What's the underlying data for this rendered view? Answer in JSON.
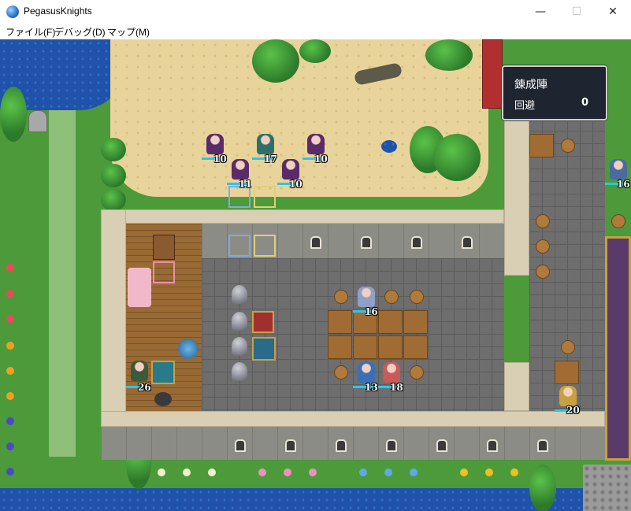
{
  "window": {
    "title": "PegasusKnights",
    "minimize_glyph": "—",
    "maximize_glyph": "☐",
    "close_glyph": "✕"
  },
  "menu": {
    "items": [
      "ファイル(F)",
      "デバッグ(D)",
      "マップ(M)"
    ]
  },
  "info_panel": {
    "title": "錬成陣",
    "stat_label": "回避",
    "stat_value": "0"
  },
  "units": [
    {
      "id": "enemy-1",
      "hp_label": "10",
      "color": "#5a2a6a"
    },
    {
      "id": "enemy-2",
      "hp_label": "17",
      "color": "#2f6f6a"
    },
    {
      "id": "enemy-3",
      "hp_label": "10",
      "color": "#5a2a6a"
    },
    {
      "id": "enemy-4",
      "hp_label": "11",
      "color": "#5a2a6a"
    },
    {
      "id": "enemy-5",
      "hp_label": "10",
      "color": "#5a2a6a"
    },
    {
      "id": "ally-1",
      "hp_label": "16",
      "color": "#8fa0c8"
    },
    {
      "id": "ally-2",
      "hp_label": "13",
      "color": "#3a6fb8"
    },
    {
      "id": "ally-3",
      "hp_label": "18",
      "color": "#c85a5a"
    },
    {
      "id": "npc-1",
      "hp_label": "26",
      "color": "#3a5a3a"
    },
    {
      "id": "npc-2",
      "hp_label": "16",
      "color": "#4a6aa0"
    },
    {
      "id": "npc-3",
      "hp_label": "20",
      "color": "#c8a040"
    }
  ],
  "colors": {
    "hp_bar": "#29c7e8",
    "selection_blue": "#7fa9e6",
    "selection_yellow": "#dcd07a",
    "panel_bg": "#1e2430"
  }
}
